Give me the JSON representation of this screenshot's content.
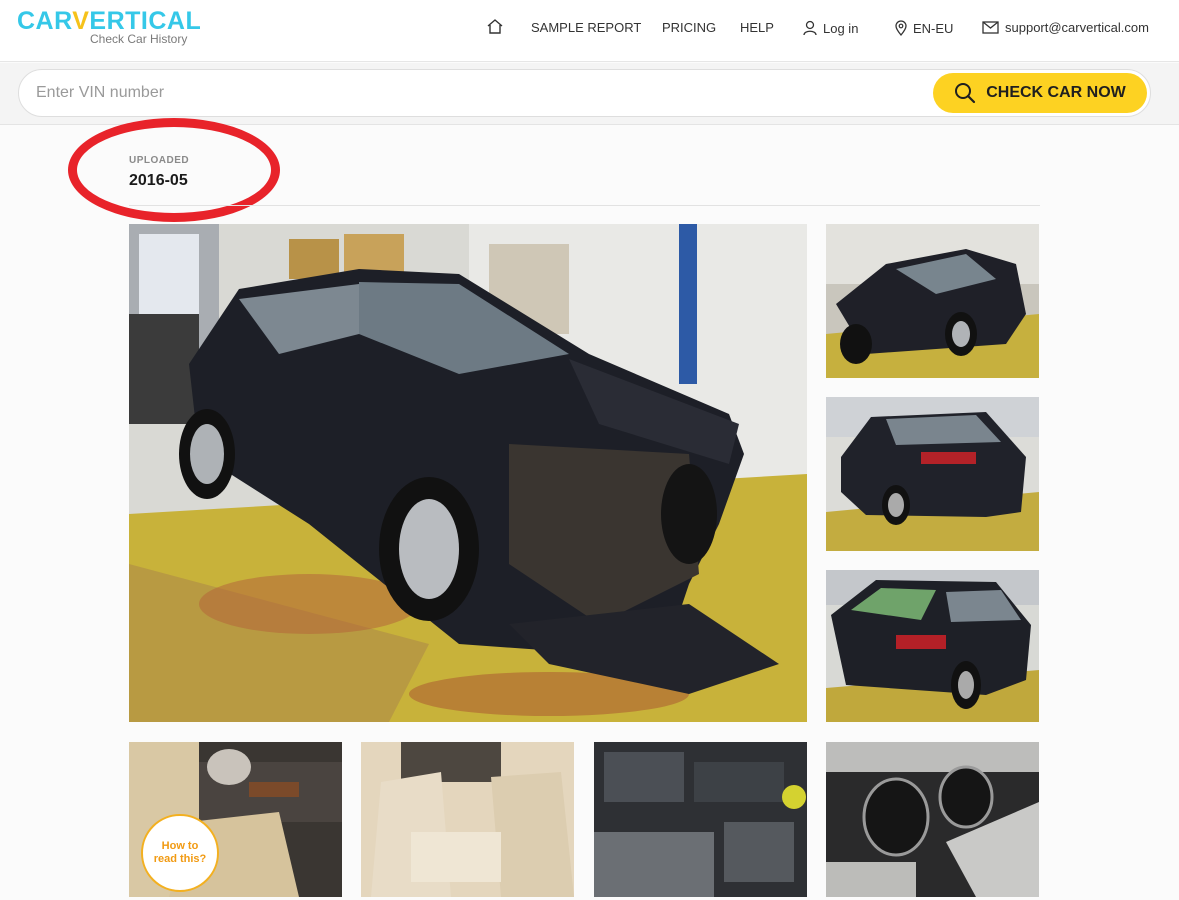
{
  "brand": {
    "name_part1": "CAR",
    "name_v": "V",
    "name_part2": "ERTICAL",
    "tagline": "Check Car History"
  },
  "nav": {
    "home_icon": "home-icon",
    "sample_report": "SAMPLE REPORT",
    "pricing": "PRICING",
    "help": "HELP",
    "login": "Log in",
    "language": "EN-EU",
    "email": "support@carvertical.com"
  },
  "search": {
    "placeholder": "Enter VIN number",
    "value": "",
    "button_label": "CHECK CAR NOW"
  },
  "upload": {
    "label": "UPLOADED",
    "date": "2016-05"
  },
  "help_bubble": {
    "line1": "How to",
    "line2": "read this?"
  },
  "colors": {
    "brand_blue": "#35c8e8",
    "brand_yellow": "#fdd222",
    "annotation_red": "#e8232a"
  }
}
